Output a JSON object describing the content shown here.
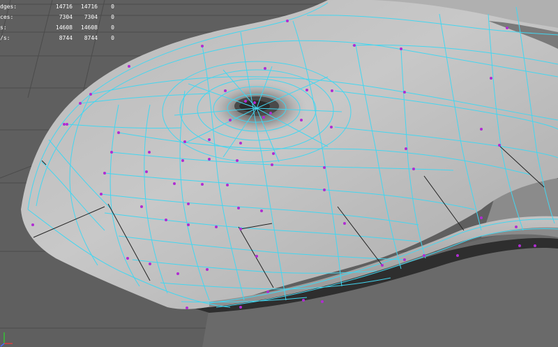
{
  "hud": {
    "rows": [
      {
        "label": "dges:",
        "values": [
          "14716",
          "14716",
          "0"
        ]
      },
      {
        "label": "ces:",
        "values": [
          "7304",
          "7304",
          "0"
        ]
      },
      {
        "label": "s:",
        "values": [
          "14608",
          "14608",
          "0"
        ]
      },
      {
        "label": "/s:",
        "values": [
          "8744",
          "8744",
          "0"
        ]
      }
    ]
  },
  "colors": {
    "background": "#5f5f5f",
    "grid": "#4a4a4a",
    "wireframe": "#43d6f0",
    "vertex": "#b02cd2",
    "mesh_light": "#c8c8c8",
    "mesh_dark": "#8a8a8a"
  },
  "viewport": {
    "axis_indicator": "xyz-axis-icon"
  }
}
